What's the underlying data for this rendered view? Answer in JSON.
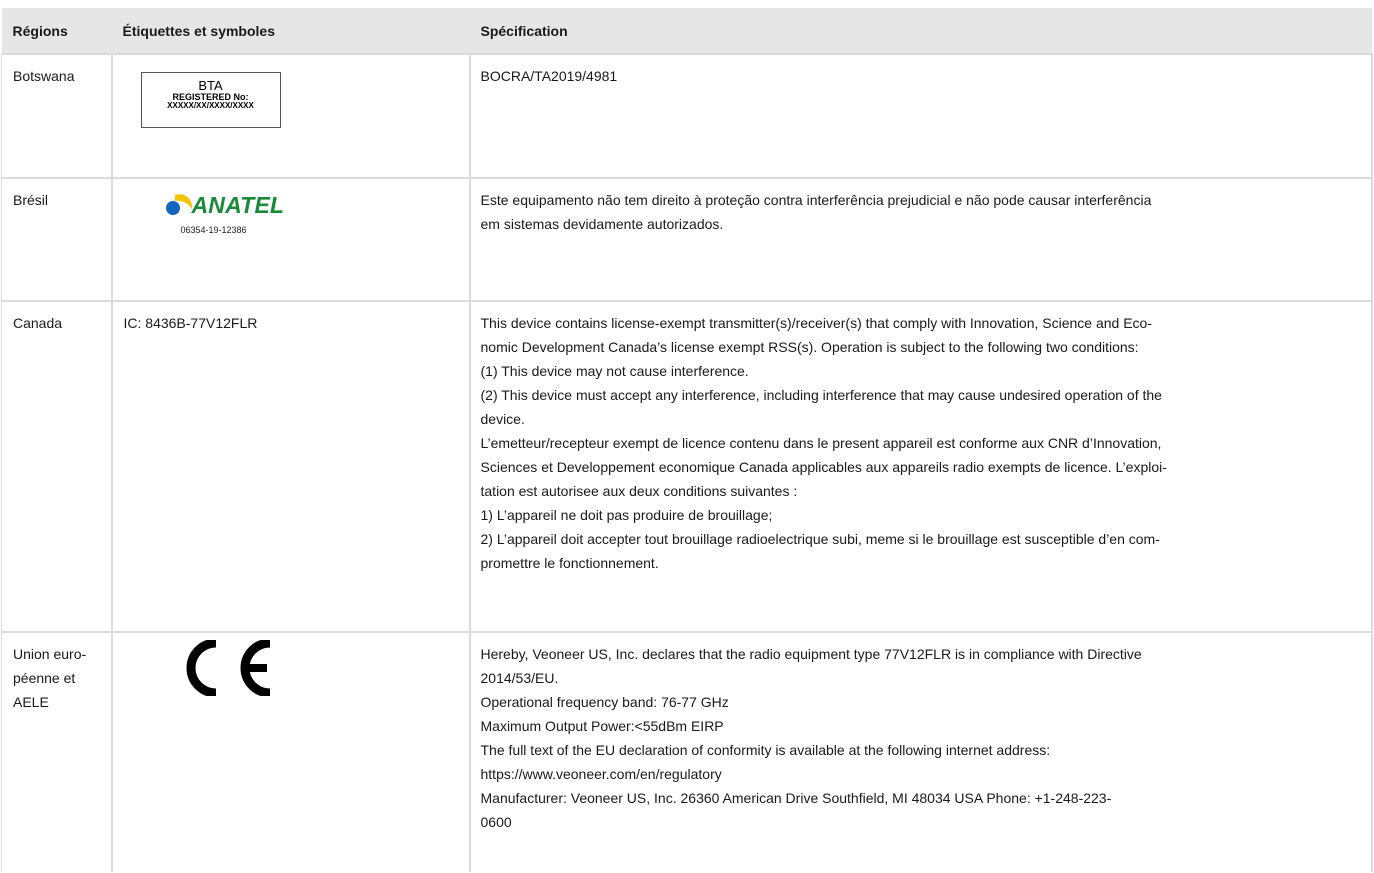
{
  "table": {
    "headers": {
      "region": "Régions",
      "labels": "Étiquettes et symboles",
      "spec": "Spécification"
    },
    "rows": [
      {
        "region": "Botswana",
        "label_type": "bta-box",
        "bta": {
          "title": "BTA",
          "registered": "REGISTERED No:",
          "number": "XXXXX/XX/XXXX/XXXX"
        },
        "spec": [
          "BOCRA/TA2019/4981"
        ]
      },
      {
        "region": "Brésil",
        "label_type": "anatel-logo",
        "anatel": {
          "word": "ANATEL",
          "number": "06354-19-12386",
          "colors": {
            "green": "#1a8a3a",
            "blue": "#1565c0",
            "yellow": "#f5c400"
          }
        },
        "spec": [
          "Este equipamento não tem direito à proteção contra interferência prejudicial e não pode causar interferência",
          "em sistemas devidamente autorizados."
        ]
      },
      {
        "region": "Canada",
        "label_type": "text",
        "label_text": "IC: 8436B-77V12FLR",
        "spec": [
          "This device contains license-exempt transmitter(s)/receiver(s) that comply with Innovation, Science and Eco-",
          "nomic Development Canada’s license exempt RSS(s). Operation is subject to the following two conditions:",
          "(1) This device may not cause interference.",
          "(2) This device must accept any interference, including interference that may cause undesired operation of the",
          "device.",
          "L’emetteur/recepteur exempt de licence contenu dans le present appareil est conforme aux CNR d’Innovation,",
          "Sciences et Developpement economique Canada applicables aux appareils radio exempts de licence. L’exploi-",
          "tation est autorisee aux deux conditions suivantes :",
          "1) L’appareil ne doit pas produire de brouillage;",
          "2) L’appareil doit accepter tout brouillage radioelectrique subi, meme si le brouillage est susceptible d’en com-",
          "promettre le fonctionnement."
        ]
      },
      {
        "region_lines": [
          "Union euro-",
          "péenne et",
          "AELE"
        ],
        "label_type": "ce-mark",
        "spec": [
          "Hereby, Veoneer US, Inc. declares that the radio equipment type 77V12FLR is in compliance with Directive",
          "2014/53/EU.",
          "Operational frequency band: 76-77 GHz",
          "Maximum Output Power:<55dBm EIRP",
          "The full text of the EU declaration of conformity is available at the following internet address:",
          "https://www.veoneer.com/en/regulatory",
          "Manufacturer: Veoneer US, Inc. 26360 American Drive Southfield, MI 48034 USA Phone: +1-248-223-",
          "0600"
        ]
      }
    ]
  }
}
